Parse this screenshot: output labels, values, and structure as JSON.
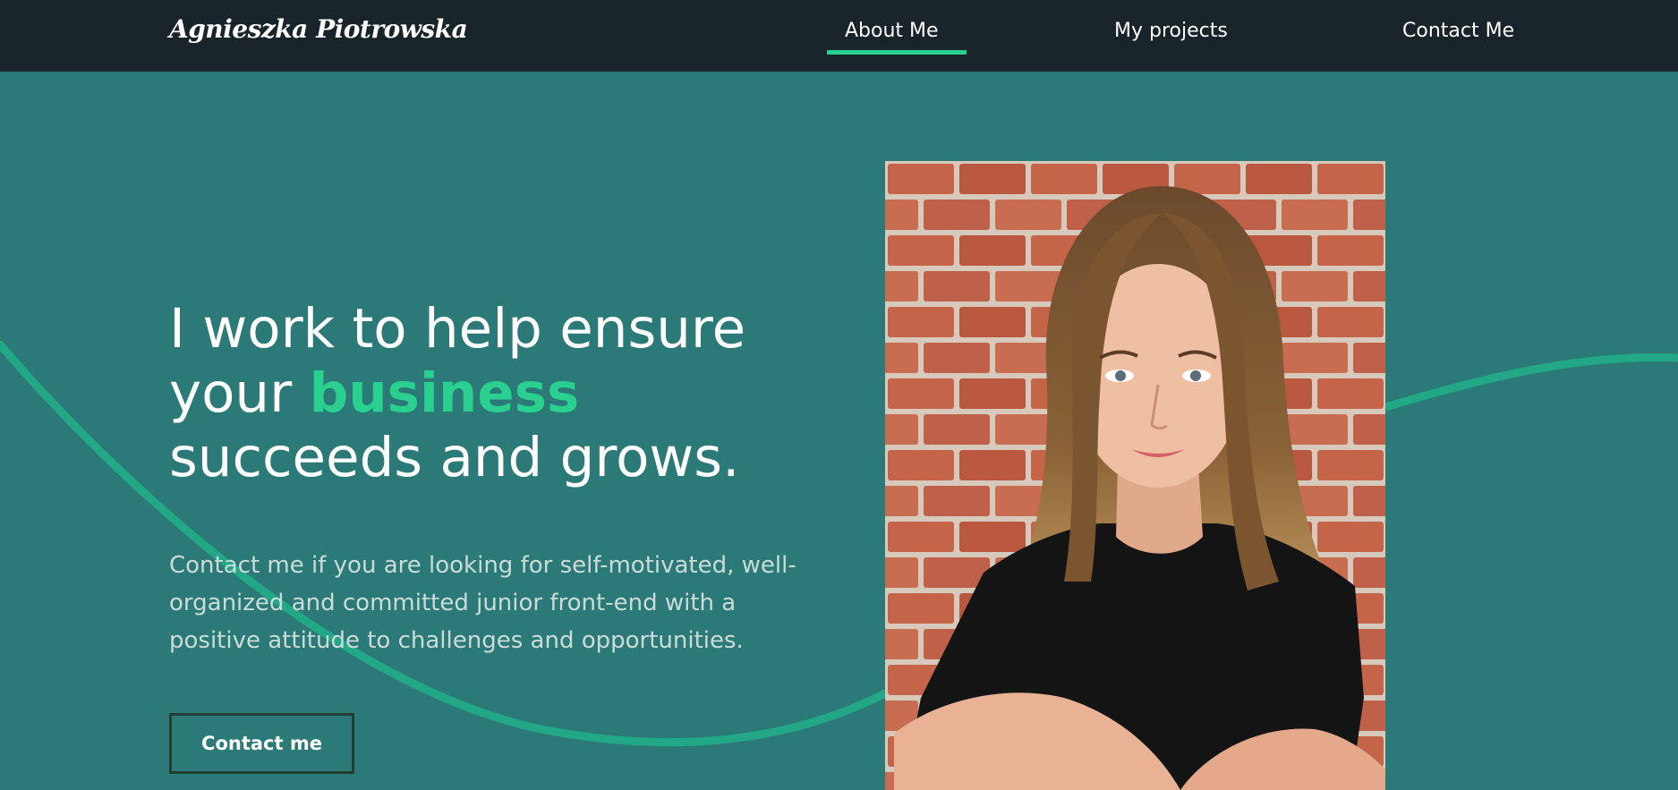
{
  "header": {
    "logo": "Agnieszka Piotrowska",
    "nav": [
      {
        "label": "About Me",
        "active": true
      },
      {
        "label": "My projects",
        "active": false
      },
      {
        "label": "Contact Me",
        "active": false
      }
    ]
  },
  "hero": {
    "headline_before": "I work to help ensure your ",
    "headline_accent": "business",
    "headline_after": " succeeds and grows.",
    "intro": "Contact me if you are looking for self-motivated, well-organized and committed junior front-end with a positive attitude to challenges and opportunities.",
    "cta_label": "Contact me"
  },
  "colors": {
    "page_background": "#2c7a78",
    "header_background": "#18232a",
    "accent": "#2ad08f"
  }
}
